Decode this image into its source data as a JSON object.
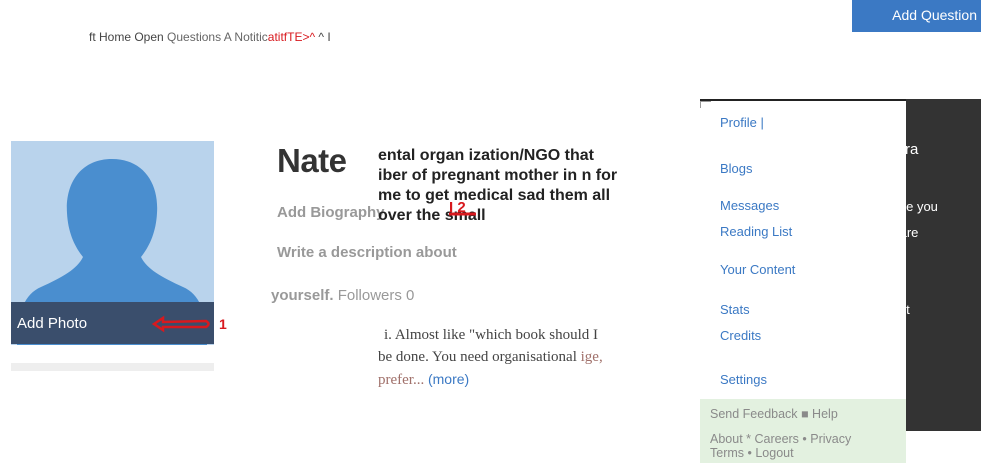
{
  "header": {
    "add_question_label": "Add Question",
    "nav_prefix": "ft Home Open",
    "nav_questions": "Questions A Notitic",
    "nav_red": "atitfTE>^",
    "nav_suffix": " ^ I"
  },
  "profile": {
    "add_photo_label": "Add Photo",
    "annotation_1": "1",
    "name": "Nate",
    "add_biography": "Add Biography",
    "annotation_2": "I 2",
    "write_description": "Write a description about",
    "yourself": "yourself.",
    "followers": "Followers 0"
  },
  "overlay_text": {
    "lines": [
      " ental organ ization/NGO that",
      "iber of pregnant mother in n for",
      "me to get medical sad them all",
      "over the small"
    ]
  },
  "answer_snippet": {
    "line1": "i. Almost like \"which book should I",
    "line2_a": "be done. You need organisational ",
    "line2_b": "ige,",
    "line3_a": "prefer... ",
    "more": "(more)"
  },
  "dark_card": {
    "t1": "ra",
    "t2": "Ike you",
    "t3": "tare",
    "t4": ")llt"
  },
  "dropdown": {
    "items": [
      "Profile |",
      "Blogs",
      "Messages",
      "Reading List",
      "Your Content",
      "Stats",
      "Credits",
      "Settings"
    ],
    "footer_line1": "Send Feedback ■ Help",
    "footer_line2": "About * Careers • Privacy",
    "footer_line3": "Terms • Logout"
  },
  "colors": {
    "accent_blue": "#3b79c4",
    "annotation_red": "#d8191e",
    "dark_card": "#333333",
    "footer_green": "#e3f1e0"
  }
}
